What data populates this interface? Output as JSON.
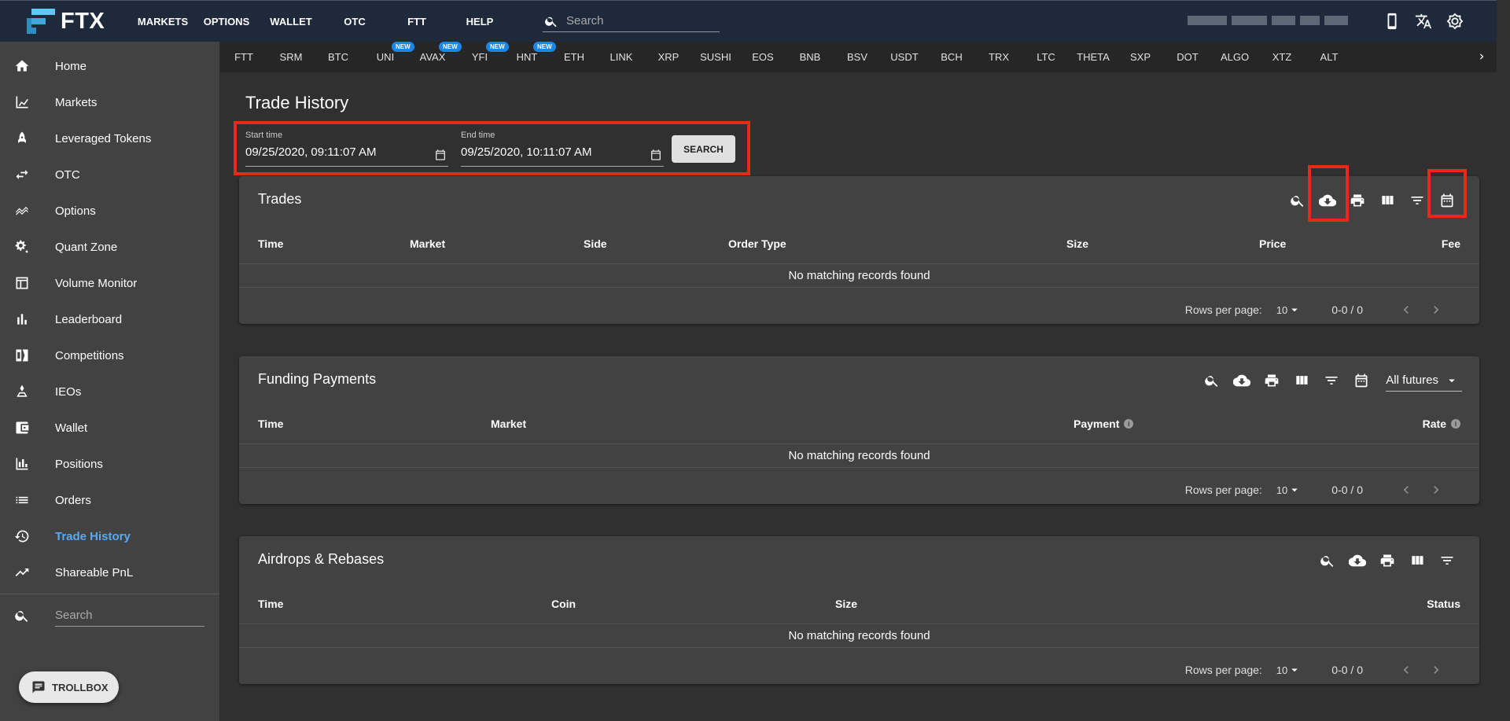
{
  "brand": {
    "name": "FTX",
    "primary": "#1e2a3b",
    "accent": "#5aa9f5",
    "highlight": "#e62a18"
  },
  "nav": [
    {
      "label": "MARKETS"
    },
    {
      "label": "OPTIONS"
    },
    {
      "label": "WALLET"
    },
    {
      "label": "OTC"
    },
    {
      "label": "FTT"
    },
    {
      "label": "HELP"
    }
  ],
  "top_search": {
    "placeholder": "Search"
  },
  "ticker": [
    {
      "label": "FTT",
      "badge": ""
    },
    {
      "label": "SRM",
      "badge": ""
    },
    {
      "label": "BTC",
      "badge": ""
    },
    {
      "label": "UNI",
      "badge": "NEW"
    },
    {
      "label": "AVAX",
      "badge": "NEW"
    },
    {
      "label": "YFI",
      "badge": "NEW"
    },
    {
      "label": "HNT",
      "badge": "NEW"
    },
    {
      "label": "ETH",
      "badge": ""
    },
    {
      "label": "LINK",
      "badge": ""
    },
    {
      "label": "XRP",
      "badge": ""
    },
    {
      "label": "SUSHI",
      "badge": ""
    },
    {
      "label": "EOS",
      "badge": ""
    },
    {
      "label": "BNB",
      "badge": ""
    },
    {
      "label": "BSV",
      "badge": ""
    },
    {
      "label": "USDT",
      "badge": ""
    },
    {
      "label": "BCH",
      "badge": ""
    },
    {
      "label": "TRX",
      "badge": ""
    },
    {
      "label": "LTC",
      "badge": ""
    },
    {
      "label": "THETA",
      "badge": ""
    },
    {
      "label": "SXP",
      "badge": ""
    },
    {
      "label": "DOT",
      "badge": ""
    },
    {
      "label": "ALGO",
      "badge": ""
    },
    {
      "label": "XTZ",
      "badge": ""
    },
    {
      "label": "ALT",
      "badge": ""
    }
  ],
  "sidebar": {
    "items": [
      {
        "label": "Home",
        "icon": "home-icon"
      },
      {
        "label": "Markets",
        "icon": "markets-icon"
      },
      {
        "label": "Leveraged Tokens",
        "icon": "rocket-icon"
      },
      {
        "label": "OTC",
        "icon": "swap-icon"
      },
      {
        "label": "Options",
        "icon": "options-icon"
      },
      {
        "label": "Quant Zone",
        "icon": "gears-icon"
      },
      {
        "label": "Volume Monitor",
        "icon": "table-icon"
      },
      {
        "label": "Leaderboard",
        "icon": "bar-chart-icon"
      },
      {
        "label": "Competitions",
        "icon": "competitions-icon"
      },
      {
        "label": "IEOs",
        "icon": "ieo-icon"
      },
      {
        "label": "Wallet",
        "icon": "wallet-icon"
      },
      {
        "label": "Positions",
        "icon": "positions-icon"
      },
      {
        "label": "Orders",
        "icon": "list-icon"
      },
      {
        "label": "Trade History",
        "icon": "history-icon",
        "active": true
      },
      {
        "label": "Shareable PnL",
        "icon": "trending-up-icon"
      }
    ],
    "search_placeholder": "Search"
  },
  "trollbox": {
    "label": "TROLLBOX"
  },
  "page": {
    "title": "Trade History",
    "start_label": "Start time",
    "start_value": "09/25/2020, 09:11:07 AM",
    "end_label": "End time",
    "end_value": "09/25/2020, 10:11:07 AM",
    "search_button": "SEARCH"
  },
  "trades": {
    "title": "Trades",
    "columns": [
      "Time",
      "Market",
      "Side",
      "Order Type",
      "Size",
      "Price",
      "Fee"
    ],
    "empty": "No matching records found",
    "rows_label": "Rows per page:",
    "rows_value": "10",
    "range": "0-0 / 0"
  },
  "funding": {
    "title": "Funding Payments",
    "columns": [
      "Time",
      "Market",
      "Payment",
      "Rate"
    ],
    "filter_value": "All futures",
    "empty": "No matching records found",
    "rows_label": "Rows per page:",
    "rows_value": "10",
    "range": "0-0 / 0"
  },
  "airdrops": {
    "title": "Airdrops & Rebases",
    "columns": [
      "Time",
      "Coin",
      "Size",
      "Status"
    ],
    "empty": "No matching records found",
    "rows_label": "Rows per page:",
    "rows_value": "10",
    "range": "0-0 / 0"
  }
}
